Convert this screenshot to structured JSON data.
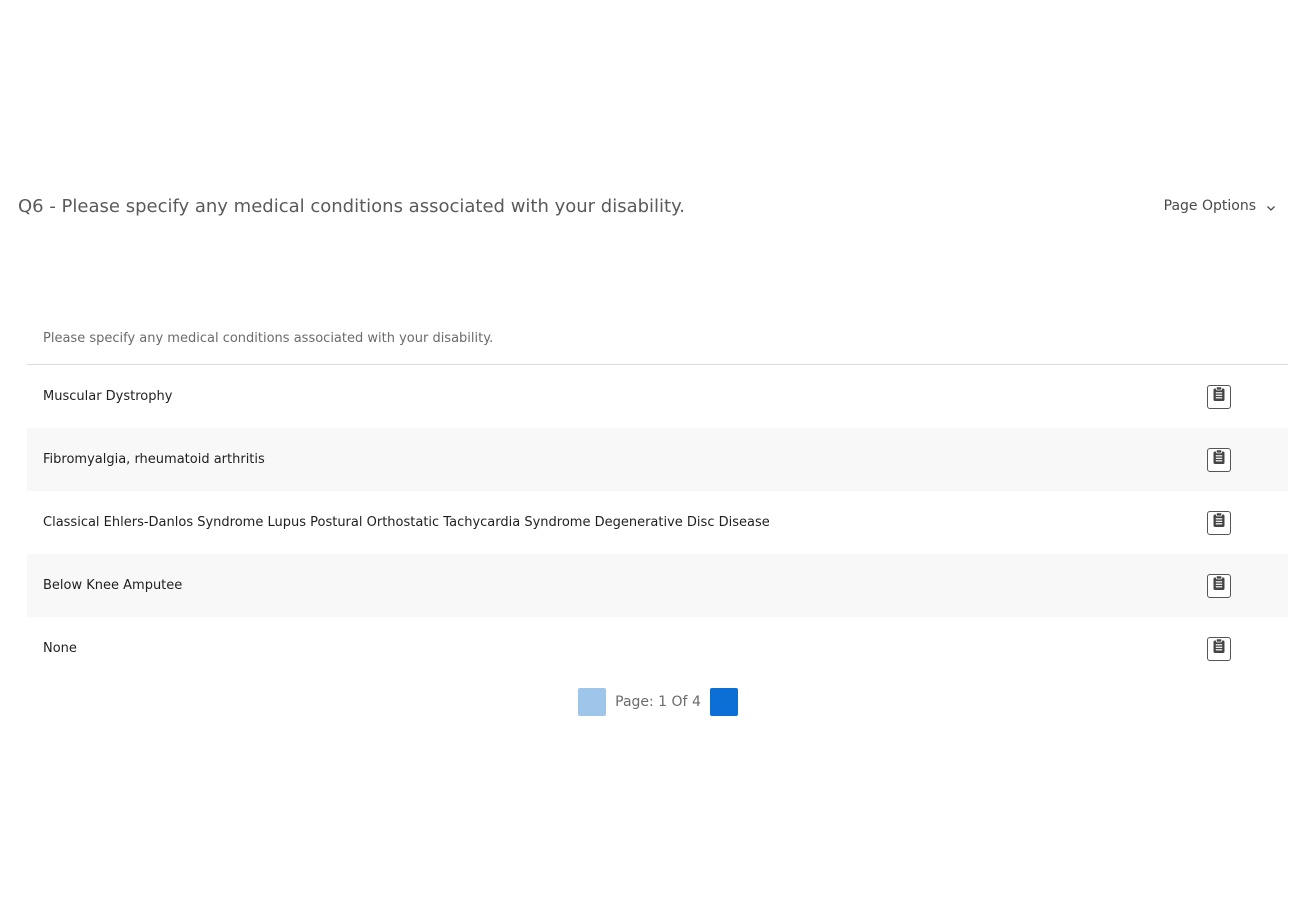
{
  "header": {
    "question_title": "Q6 - Please specify any medical conditions associated with your disability.",
    "page_options_label": "Page Options",
    "page_options_icon": "chevron-down-icon"
  },
  "table": {
    "column_header": "Please specify any medical conditions associated with your disability.",
    "row_icon": "clipboard-icon",
    "rows": [
      {
        "text": "Muscular Dystrophy"
      },
      {
        "text": "Fibromyalgia, rheumatoid arthritis"
      },
      {
        "text": "Classical Ehlers-Danlos Syndrome Lupus Postural Orthostatic Tachycardia Syndrome Degenerative Disc Disease"
      },
      {
        "text": "Below Knee Amputee"
      },
      {
        "text": "None"
      }
    ]
  },
  "pager": {
    "text": "Page: 1 Of 4",
    "prev_color": "#9ec5ea",
    "next_color": "#0b6fd6"
  }
}
